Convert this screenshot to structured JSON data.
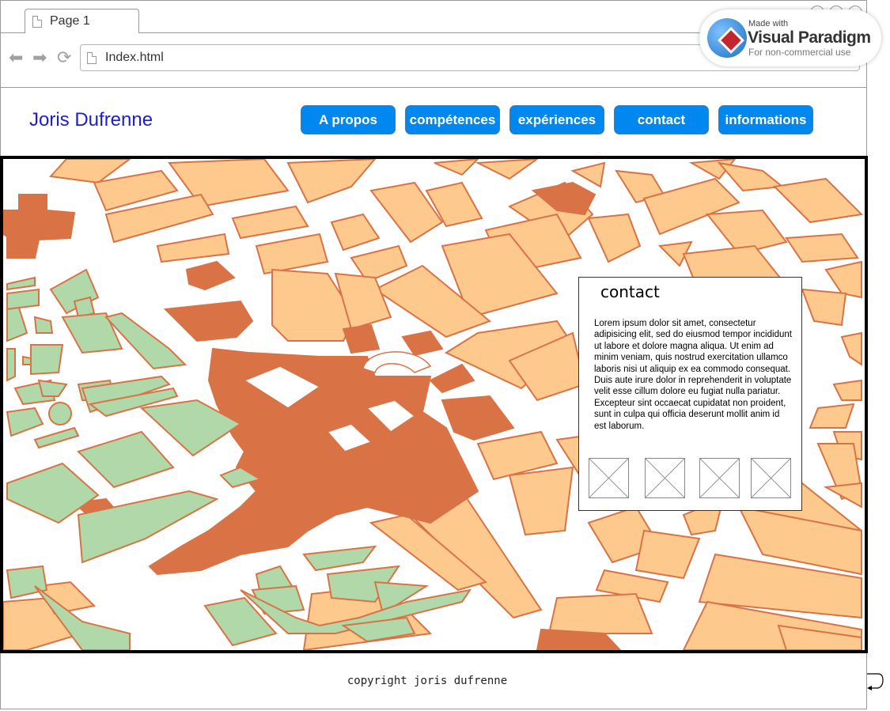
{
  "browser": {
    "tab_label": "Page 1",
    "url": "Index.html"
  },
  "badge": {
    "made_with": "Made with",
    "brand": "Visual Paradigm",
    "note": "For non-commercial use"
  },
  "header": {
    "site_title": "Joris Dufrenne",
    "menu": [
      "A propos",
      "compétences",
      "expériences",
      "contact",
      "informations"
    ]
  },
  "hero": {
    "image": "city-map",
    "colors": {
      "building": "#fec98d",
      "plaza": "#d97346",
      "park": "#b0d8a9",
      "outline": "#d97346"
    }
  },
  "contact": {
    "title": "contact",
    "body": "Lorem ipsum dolor sit amet, consectetur adipisicing elit, sed do eiusmod tempor incididunt ut labore et dolore magna aliqua. Ut enim ad minim veniam, quis nostrud exercitation ullamco laboris nisi ut aliquip ex ea commodo consequat. Duis aute irure dolor in reprehenderit in voluptate velit esse cillum dolore eu fugiat nulla pariatur. Excepteur sint occaecat cupidatat non proident, sunt in culpa qui officia deserunt mollit anim id est laborum.",
    "thumbnails": 4
  },
  "footer": {
    "copyright": "copyright joris dufrenne"
  }
}
